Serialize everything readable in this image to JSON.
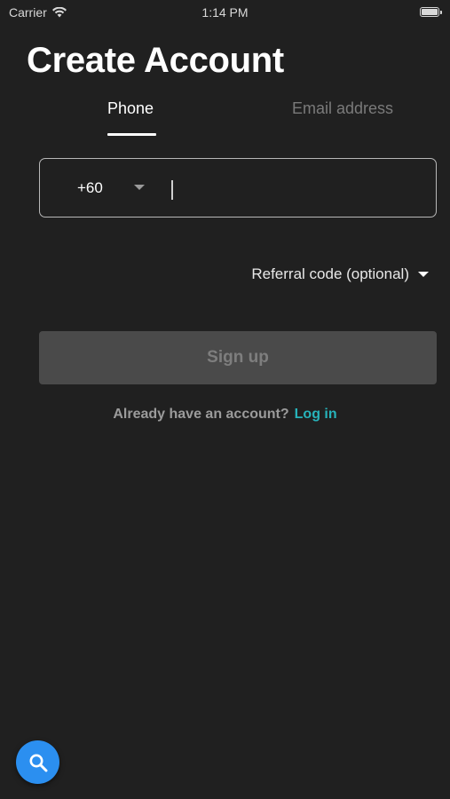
{
  "status_bar": {
    "carrier": "Carrier",
    "time": "1:14 PM",
    "icons": [
      "wifi-icon",
      "battery-icon"
    ]
  },
  "page": {
    "title": "Create Account"
  },
  "tabs": [
    {
      "label": "Phone",
      "active": true
    },
    {
      "label": "Email address",
      "active": false
    }
  ],
  "phone_field": {
    "country_code": "+60",
    "value": "",
    "placeholder": ""
  },
  "referral": {
    "label": "Referral code (optional)"
  },
  "signup": {
    "label": "Sign up",
    "enabled": false
  },
  "login_prompt": {
    "text": "Already have an account?",
    "link_label": "Log in"
  },
  "colors": {
    "background": "#202020",
    "accent_link": "#27b3ba",
    "fab": "#2b8ff0",
    "button_disabled": "#4a4a4a"
  },
  "fab": {
    "icon": "search-icon"
  }
}
